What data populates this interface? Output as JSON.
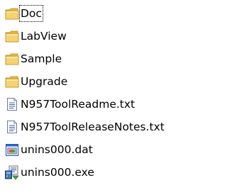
{
  "files": [
    {
      "name": "Doc",
      "icon": "folder-icon",
      "focused": true
    },
    {
      "name": "LabView",
      "icon": "folder-icon"
    },
    {
      "name": "Sample",
      "icon": "folder-icon"
    },
    {
      "name": "Upgrade",
      "icon": "folder-icon"
    },
    {
      "name": "N957ToolReadme.txt",
      "icon": "text-file-icon"
    },
    {
      "name": "N957ToolReleaseNotes.txt",
      "icon": "text-file-icon"
    },
    {
      "name": "unins000.dat",
      "icon": "data-file-icon"
    },
    {
      "name": "unins000.exe",
      "icon": "installer-icon"
    }
  ],
  "colors": {
    "folder_body": "#f7d370",
    "folder_edge": "#c49a2c",
    "text_color": "#000000"
  }
}
